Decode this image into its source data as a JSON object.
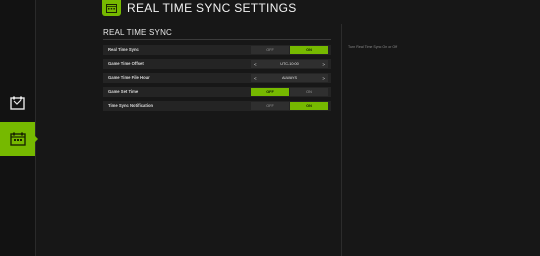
{
  "header": {
    "title": "REAL TIME SYNC SETTINGS"
  },
  "section": {
    "title": "REAL TIME SYNC"
  },
  "help": {
    "text": "Turn Real Time Sync On or Off"
  },
  "rows": [
    {
      "label": "Real Time Sync",
      "type": "toggle",
      "off": "OFF",
      "on": "ON",
      "selected": "on"
    },
    {
      "label": "Game Time Offset",
      "type": "selector",
      "value": "UTC-10:00",
      "prev": "<",
      "next": ">"
    },
    {
      "label": "Game Time File Hour",
      "type": "selector",
      "value": "ALWAYS",
      "prev": "<",
      "next": ">"
    },
    {
      "label": "Game Set Time",
      "type": "toggle",
      "off": "OFF",
      "on": "ON",
      "selected": "off"
    },
    {
      "label": "Time Sync Notification",
      "type": "toggle",
      "off": "OFF",
      "on": "ON",
      "selected": "on"
    }
  ],
  "sidebar": {
    "items": [
      {
        "icon": "map-icon",
        "active": false
      },
      {
        "icon": "calendar-sync-icon",
        "active": true
      }
    ]
  },
  "colors": {
    "accent": "#76b900",
    "background": "#171717",
    "row": "#242424"
  }
}
